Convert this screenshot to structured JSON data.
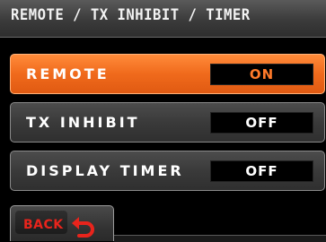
{
  "header": {
    "title": "REMOTE / TX INHIBIT / TIMER"
  },
  "menu": {
    "items": [
      {
        "label": "REMOTE",
        "value": "ON",
        "selected": true
      },
      {
        "label": "TX INHIBIT",
        "value": "OFF",
        "selected": false
      },
      {
        "label": "DISPLAY TIMER",
        "value": "OFF",
        "selected": false
      }
    ]
  },
  "footer": {
    "back_label": "BACK",
    "back_icon": "return-arrow-icon"
  },
  "colors": {
    "accent": "#f06a1c",
    "back_text": "#e8241c",
    "background": "#000000"
  }
}
